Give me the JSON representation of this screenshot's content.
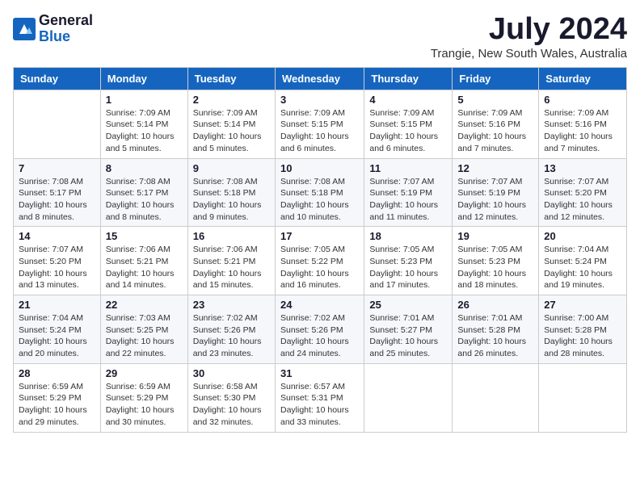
{
  "logo": {
    "line1": "General",
    "line2": "Blue"
  },
  "title": "July 2024",
  "location": "Trangie, New South Wales, Australia",
  "weekdays": [
    "Sunday",
    "Monday",
    "Tuesday",
    "Wednesday",
    "Thursday",
    "Friday",
    "Saturday"
  ],
  "weeks": [
    [
      {
        "day": "",
        "sunrise": "",
        "sunset": "",
        "daylight": ""
      },
      {
        "day": "1",
        "sunrise": "Sunrise: 7:09 AM",
        "sunset": "Sunset: 5:14 PM",
        "daylight": "Daylight: 10 hours and 5 minutes."
      },
      {
        "day": "2",
        "sunrise": "Sunrise: 7:09 AM",
        "sunset": "Sunset: 5:14 PM",
        "daylight": "Daylight: 10 hours and 5 minutes."
      },
      {
        "day": "3",
        "sunrise": "Sunrise: 7:09 AM",
        "sunset": "Sunset: 5:15 PM",
        "daylight": "Daylight: 10 hours and 6 minutes."
      },
      {
        "day": "4",
        "sunrise": "Sunrise: 7:09 AM",
        "sunset": "Sunset: 5:15 PM",
        "daylight": "Daylight: 10 hours and 6 minutes."
      },
      {
        "day": "5",
        "sunrise": "Sunrise: 7:09 AM",
        "sunset": "Sunset: 5:16 PM",
        "daylight": "Daylight: 10 hours and 7 minutes."
      },
      {
        "day": "6",
        "sunrise": "Sunrise: 7:09 AM",
        "sunset": "Sunset: 5:16 PM",
        "daylight": "Daylight: 10 hours and 7 minutes."
      }
    ],
    [
      {
        "day": "7",
        "sunrise": "Sunrise: 7:08 AM",
        "sunset": "Sunset: 5:17 PM",
        "daylight": "Daylight: 10 hours and 8 minutes."
      },
      {
        "day": "8",
        "sunrise": "Sunrise: 7:08 AM",
        "sunset": "Sunset: 5:17 PM",
        "daylight": "Daylight: 10 hours and 8 minutes."
      },
      {
        "day": "9",
        "sunrise": "Sunrise: 7:08 AM",
        "sunset": "Sunset: 5:18 PM",
        "daylight": "Daylight: 10 hours and 9 minutes."
      },
      {
        "day": "10",
        "sunrise": "Sunrise: 7:08 AM",
        "sunset": "Sunset: 5:18 PM",
        "daylight": "Daylight: 10 hours and 10 minutes."
      },
      {
        "day": "11",
        "sunrise": "Sunrise: 7:07 AM",
        "sunset": "Sunset: 5:19 PM",
        "daylight": "Daylight: 10 hours and 11 minutes."
      },
      {
        "day": "12",
        "sunrise": "Sunrise: 7:07 AM",
        "sunset": "Sunset: 5:19 PM",
        "daylight": "Daylight: 10 hours and 12 minutes."
      },
      {
        "day": "13",
        "sunrise": "Sunrise: 7:07 AM",
        "sunset": "Sunset: 5:20 PM",
        "daylight": "Daylight: 10 hours and 12 minutes."
      }
    ],
    [
      {
        "day": "14",
        "sunrise": "Sunrise: 7:07 AM",
        "sunset": "Sunset: 5:20 PM",
        "daylight": "Daylight: 10 hours and 13 minutes."
      },
      {
        "day": "15",
        "sunrise": "Sunrise: 7:06 AM",
        "sunset": "Sunset: 5:21 PM",
        "daylight": "Daylight: 10 hours and 14 minutes."
      },
      {
        "day": "16",
        "sunrise": "Sunrise: 7:06 AM",
        "sunset": "Sunset: 5:21 PM",
        "daylight": "Daylight: 10 hours and 15 minutes."
      },
      {
        "day": "17",
        "sunrise": "Sunrise: 7:05 AM",
        "sunset": "Sunset: 5:22 PM",
        "daylight": "Daylight: 10 hours and 16 minutes."
      },
      {
        "day": "18",
        "sunrise": "Sunrise: 7:05 AM",
        "sunset": "Sunset: 5:23 PM",
        "daylight": "Daylight: 10 hours and 17 minutes."
      },
      {
        "day": "19",
        "sunrise": "Sunrise: 7:05 AM",
        "sunset": "Sunset: 5:23 PM",
        "daylight": "Daylight: 10 hours and 18 minutes."
      },
      {
        "day": "20",
        "sunrise": "Sunrise: 7:04 AM",
        "sunset": "Sunset: 5:24 PM",
        "daylight": "Daylight: 10 hours and 19 minutes."
      }
    ],
    [
      {
        "day": "21",
        "sunrise": "Sunrise: 7:04 AM",
        "sunset": "Sunset: 5:24 PM",
        "daylight": "Daylight: 10 hours and 20 minutes."
      },
      {
        "day": "22",
        "sunrise": "Sunrise: 7:03 AM",
        "sunset": "Sunset: 5:25 PM",
        "daylight": "Daylight: 10 hours and 22 minutes."
      },
      {
        "day": "23",
        "sunrise": "Sunrise: 7:02 AM",
        "sunset": "Sunset: 5:26 PM",
        "daylight": "Daylight: 10 hours and 23 minutes."
      },
      {
        "day": "24",
        "sunrise": "Sunrise: 7:02 AM",
        "sunset": "Sunset: 5:26 PM",
        "daylight": "Daylight: 10 hours and 24 minutes."
      },
      {
        "day": "25",
        "sunrise": "Sunrise: 7:01 AM",
        "sunset": "Sunset: 5:27 PM",
        "daylight": "Daylight: 10 hours and 25 minutes."
      },
      {
        "day": "26",
        "sunrise": "Sunrise: 7:01 AM",
        "sunset": "Sunset: 5:28 PM",
        "daylight": "Daylight: 10 hours and 26 minutes."
      },
      {
        "day": "27",
        "sunrise": "Sunrise: 7:00 AM",
        "sunset": "Sunset: 5:28 PM",
        "daylight": "Daylight: 10 hours and 28 minutes."
      }
    ],
    [
      {
        "day": "28",
        "sunrise": "Sunrise: 6:59 AM",
        "sunset": "Sunset: 5:29 PM",
        "daylight": "Daylight: 10 hours and 29 minutes."
      },
      {
        "day": "29",
        "sunrise": "Sunrise: 6:59 AM",
        "sunset": "Sunset: 5:29 PM",
        "daylight": "Daylight: 10 hours and 30 minutes."
      },
      {
        "day": "30",
        "sunrise": "Sunrise: 6:58 AM",
        "sunset": "Sunset: 5:30 PM",
        "daylight": "Daylight: 10 hours and 32 minutes."
      },
      {
        "day": "31",
        "sunrise": "Sunrise: 6:57 AM",
        "sunset": "Sunset: 5:31 PM",
        "daylight": "Daylight: 10 hours and 33 minutes."
      },
      {
        "day": "",
        "sunrise": "",
        "sunset": "",
        "daylight": ""
      },
      {
        "day": "",
        "sunrise": "",
        "sunset": "",
        "daylight": ""
      },
      {
        "day": "",
        "sunrise": "",
        "sunset": "",
        "daylight": ""
      }
    ]
  ]
}
